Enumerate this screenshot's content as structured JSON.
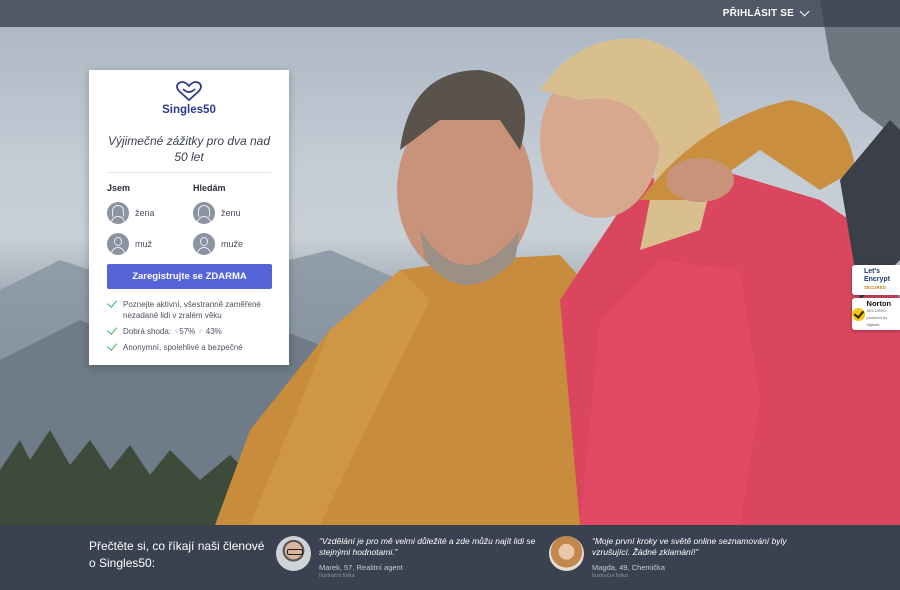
{
  "header": {
    "login_label": "PŘIHLÁSIT SE"
  },
  "signup": {
    "brand": "Singles50",
    "tagline": "Výjimečné zážitky pro dva nad 50 let",
    "i_am": {
      "title": "Jsem",
      "options": [
        "žena",
        "muž"
      ]
    },
    "looking_for": {
      "title": "Hledám",
      "options": [
        "ženu",
        "muže"
      ]
    },
    "cta_label": "Zaregistrujte se ZDARMA",
    "features": [
      "Poznejte aktivní, všestranně zaměřené nezadané lidi v zralém věku",
      "Anonymní, spolehlivé a bezpečné"
    ],
    "match": {
      "label": "Dobrá shoda:",
      "female_symbol": "♀",
      "female_pct": "57%",
      "male_symbol": "♂",
      "male_pct": "43%"
    }
  },
  "badges": {
    "letsencrypt_line1": "Let's",
    "letsencrypt_line2": "Encrypt",
    "letsencrypt_sub": "SECURED",
    "norton": "Norton",
    "norton_sub": "SECURED",
    "norton_by": "powered by digicert"
  },
  "footer": {
    "intro": "Přečtěte si, co říkají naši členové o Singles50:",
    "testimonials": [
      {
        "quote": "“Vzdělání je pro mě velmi důležité a zde můžu najít lidi se stejnými hodnotami.”",
        "author": "Marek, 57, Realitní agent",
        "note": "Ilustrační fotka"
      },
      {
        "quote": "“Moje první kroky ve světě online seznamování byly vzrušující. Žádné zklamání!”",
        "author": "Magda, 49, Chemička",
        "note": "Ilustrační fotka"
      }
    ]
  },
  "colors": {
    "brand": "#2d3a8c",
    "cta": "#5563d8",
    "check": "#3ab35f",
    "footer_bg": "#3a4150"
  }
}
